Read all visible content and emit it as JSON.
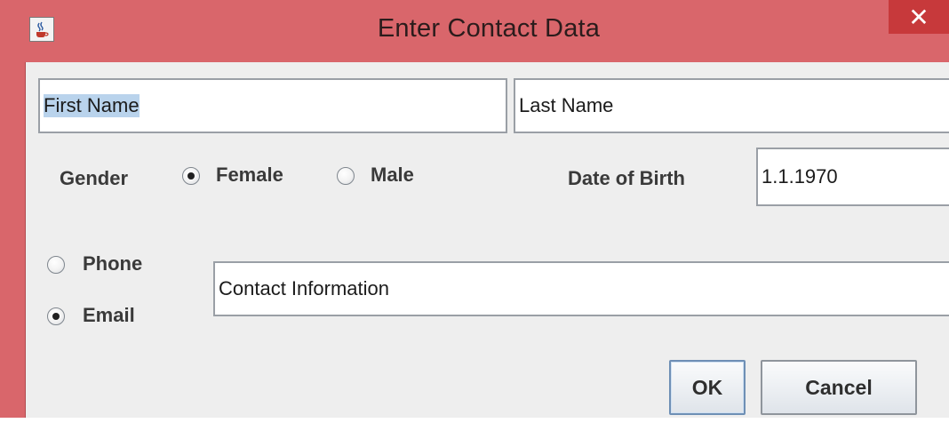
{
  "window": {
    "title": "Enter Contact Data",
    "close_glyph": "✕",
    "icon": "java-cup-icon",
    "accent_color": "#d9666b"
  },
  "name": {
    "first_name_value": "First Name",
    "last_name_value": "Last Name"
  },
  "gender": {
    "label": "Gender",
    "options": [
      {
        "label": "Female",
        "selected": true
      },
      {
        "label": "Male",
        "selected": false
      }
    ]
  },
  "date_of_birth": {
    "label": "Date of Birth",
    "value": "1.1.1970"
  },
  "contact": {
    "options": [
      {
        "label": "Phone",
        "selected": false
      },
      {
        "label": "Email",
        "selected": true
      }
    ],
    "value": "Contact Information"
  },
  "buttons": {
    "ok": "OK",
    "cancel": "Cancel"
  }
}
